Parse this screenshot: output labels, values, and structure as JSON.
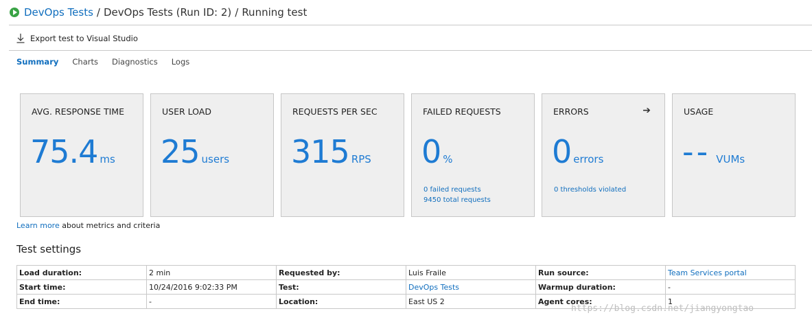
{
  "breadcrumb": {
    "project": "DevOps Tests",
    "sep1": "/",
    "run": "DevOps Tests (Run ID: 2)",
    "sep2": "/",
    "status": "Running test"
  },
  "toolbar": {
    "export_label": "Export test to Visual Studio"
  },
  "tabs": [
    {
      "label": "Summary",
      "active": true
    },
    {
      "label": "Charts",
      "active": false
    },
    {
      "label": "Diagnostics",
      "active": false
    },
    {
      "label": "Logs",
      "active": false
    }
  ],
  "tiles": {
    "avg_response": {
      "title": "AVG. RESPONSE TIME",
      "value": "75.4",
      "unit": "ms"
    },
    "user_load": {
      "title": "USER LOAD",
      "value": "25",
      "unit": "users"
    },
    "rps": {
      "title": "REQUESTS PER SEC",
      "value": "315",
      "unit": "RPS"
    },
    "failed": {
      "title": "FAILED REQUESTS",
      "value": "0",
      "unit": "%",
      "sub1": "0 failed requests",
      "sub2": "9450 total requests"
    },
    "errors": {
      "title": "ERRORS",
      "value": "0",
      "unit": "errors",
      "sub1": "0 thresholds violated"
    },
    "usage": {
      "title": "USAGE",
      "value": "--",
      "unit": "VUMs"
    }
  },
  "learn": {
    "link": "Learn more",
    "text": " about metrics and criteria"
  },
  "settings": {
    "title": "Test settings",
    "rows": [
      {
        "l1": "Load duration:",
        "v1": "2 min",
        "l2": "Requested by:",
        "v2": "Luis Fraile",
        "l3": "Run source:",
        "v3": "Team Services portal"
      },
      {
        "l1": "Start time:",
        "v1": "10/24/2016 9:02:33 PM",
        "l2": "Test:",
        "v2": "DevOps Tests",
        "l3": "Warmup duration:",
        "v3": "-"
      },
      {
        "l1": "End time:",
        "v1": "-",
        "l2": "Location:",
        "v2": "East US 2",
        "l3": "Agent cores:",
        "v3": "1"
      }
    ]
  },
  "watermark": "https://blog.csdn.net/jiangyongtao",
  "colors": {
    "accent": "#1e7bd3",
    "link": "#106ebe",
    "run_green": "#39a345",
    "tile_bg": "#efefef"
  }
}
